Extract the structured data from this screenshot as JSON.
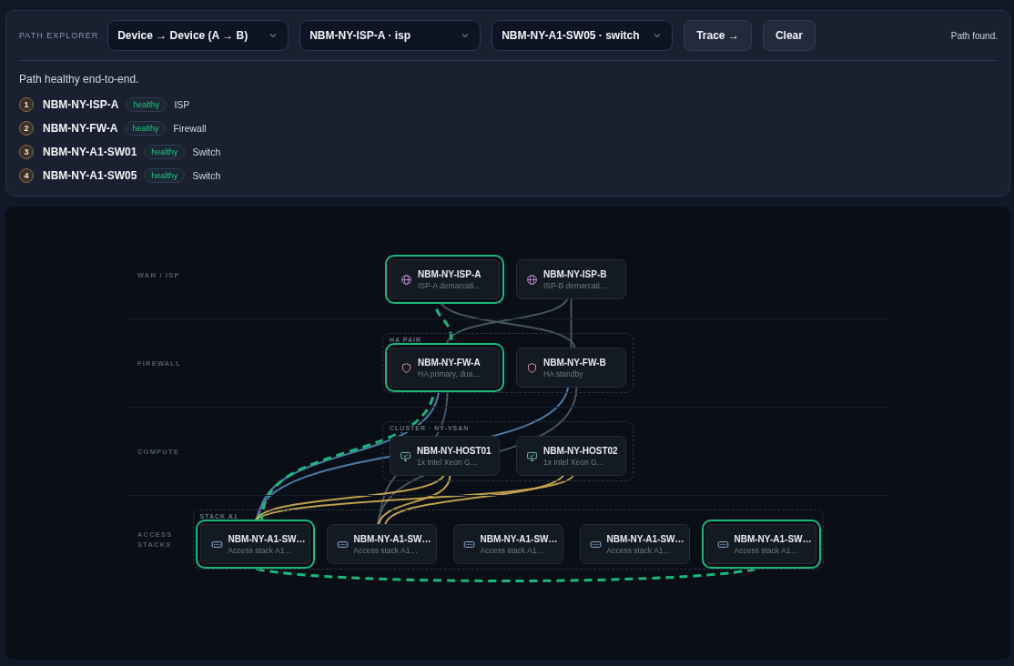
{
  "explorer": {
    "label": "PATH EXPLORER",
    "selects": [
      {
        "value": "Device → Device (A → B)"
      },
      {
        "value": "NBM-NY-ISP-A · isp"
      },
      {
        "value": "NBM-NY-A1-SW05 · switch"
      }
    ],
    "buttons": [
      "Trace →",
      "Clear"
    ],
    "status": "Path found.",
    "summary": "Path healthy end-to-end.",
    "hops": [
      {
        "step": "1",
        "name": "NBM-NY-ISP-A",
        "health": "healthy",
        "role": "ISP"
      },
      {
        "step": "2",
        "name": "NBM-NY-FW-A",
        "health": "healthy",
        "role": "Firewall"
      },
      {
        "step": "3",
        "name": "NBM-NY-A1-SW01",
        "health": "healthy",
        "role": "Switch"
      },
      {
        "step": "4",
        "name": "NBM-NY-A1-SW05",
        "health": "healthy",
        "role": "Switch"
      }
    ]
  },
  "diagram": {
    "lanes": [
      {
        "label": "WAN / ISP",
        "nodes": [
          {
            "name": "NBM-NY-ISP-A",
            "subtitle": "ISP-A demarcati…",
            "kind": "isp",
            "on_path": true
          },
          {
            "name": "NBM-NY-ISP-B",
            "subtitle": "ISP-B demarcati…",
            "kind": "isp",
            "on_path": false
          }
        ]
      },
      {
        "label": "FIREWALL",
        "group": "HA PAIR",
        "nodes": [
          {
            "name": "NBM-NY-FW-A",
            "subtitle": "HA primary, dua…",
            "kind": "firewall",
            "on_path": true
          },
          {
            "name": "NBM-NY-FW-B",
            "subtitle": "HA standby",
            "kind": "firewall",
            "on_path": false
          }
        ]
      },
      {
        "label": "COMPUTE",
        "group": "CLUSTER · NY-VSAN",
        "nodes": [
          {
            "name": "NBM-NY-HOST01",
            "subtitle": "1x Intel Xeon G…",
            "kind": "host",
            "on_path": false
          },
          {
            "name": "NBM-NY-HOST02",
            "subtitle": "1x Intel Xeon G…",
            "kind": "host",
            "on_path": false
          }
        ]
      },
      {
        "label": "ACCESS STACKS",
        "group": "STACK A1",
        "nodes": [
          {
            "name": "NBM-NY-A1-SW…",
            "subtitle": "Access stack A1…",
            "kind": "switch",
            "on_path": true
          },
          {
            "name": "NBM-NY-A1-SW…",
            "subtitle": "Access stack A1…",
            "kind": "switch",
            "on_path": false
          },
          {
            "name": "NBM-NY-A1-SW…",
            "subtitle": "Access stack A1…",
            "kind": "switch",
            "on_path": false
          },
          {
            "name": "NBM-NY-A1-SW…",
            "subtitle": "Access stack A1…",
            "kind": "switch",
            "on_path": false
          },
          {
            "name": "NBM-NY-A1-SW…",
            "subtitle": "Access stack A1…",
            "kind": "switch",
            "on_path": true
          }
        ]
      }
    ]
  }
}
